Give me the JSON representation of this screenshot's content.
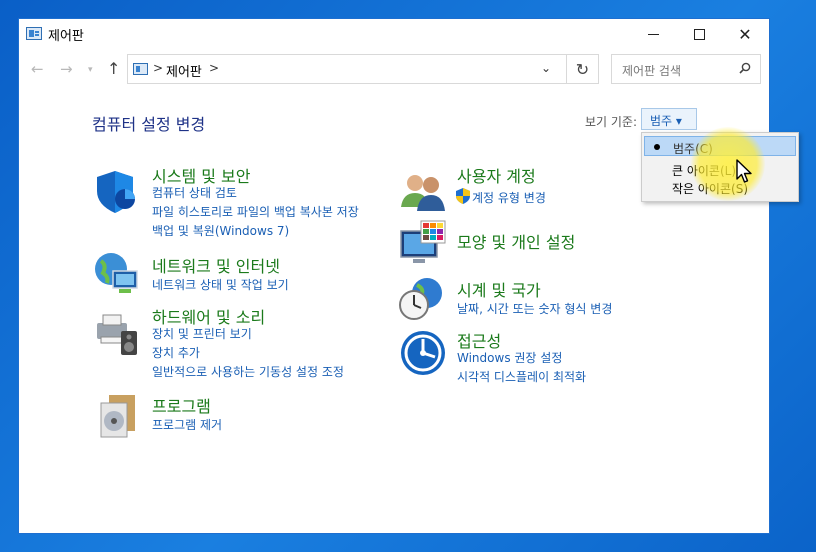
{
  "window": {
    "title": "제어판"
  },
  "address": {
    "path": "제어판",
    "sep": ">"
  },
  "search": {
    "placeholder": "제어판 검색"
  },
  "page": {
    "title": "컴퓨터 설정 변경"
  },
  "view_by": {
    "label": "보기 기준:",
    "value": "범주 ▾"
  },
  "dropdown": {
    "items": [
      "범주(C)",
      "큰 아이콘(L)",
      "작은 아이콘(S)"
    ]
  },
  "categories": [
    {
      "title": "시스템 및 보안",
      "links": [
        "컴퓨터 상태 검토",
        "파일 히스토리로 파일의 백업 복사본 저장",
        "백업 및 복원(Windows 7)"
      ]
    },
    {
      "title": "네트워크 및 인터넷",
      "links": [
        "네트워크 상태 및 작업 보기"
      ]
    },
    {
      "title": "하드웨어 및 소리",
      "links": [
        "장치 및 프린터 보기",
        "장치 추가",
        "일반적으로 사용하는 기동성 설정 조정"
      ]
    },
    {
      "title": "프로그램",
      "links": [
        "프로그램 제거"
      ]
    },
    {
      "title": "사용자 계정",
      "links": [
        "계정 유형 변경"
      ]
    },
    {
      "title": "모양 및 개인 설정",
      "links": []
    },
    {
      "title": "시계 및 국가",
      "links": [
        "날짜, 시간 또는 숫자 형식 변경"
      ]
    },
    {
      "title": "접근성",
      "links": [
        "Windows 권장 설정",
        "시각적 디스플레이 최적화"
      ]
    }
  ],
  "colors": {
    "title_green": "#1b7a1b",
    "link_blue": "#1a5fb4",
    "heading_navy": "#1e3287",
    "desktop_blue": "#0a5fc7"
  }
}
